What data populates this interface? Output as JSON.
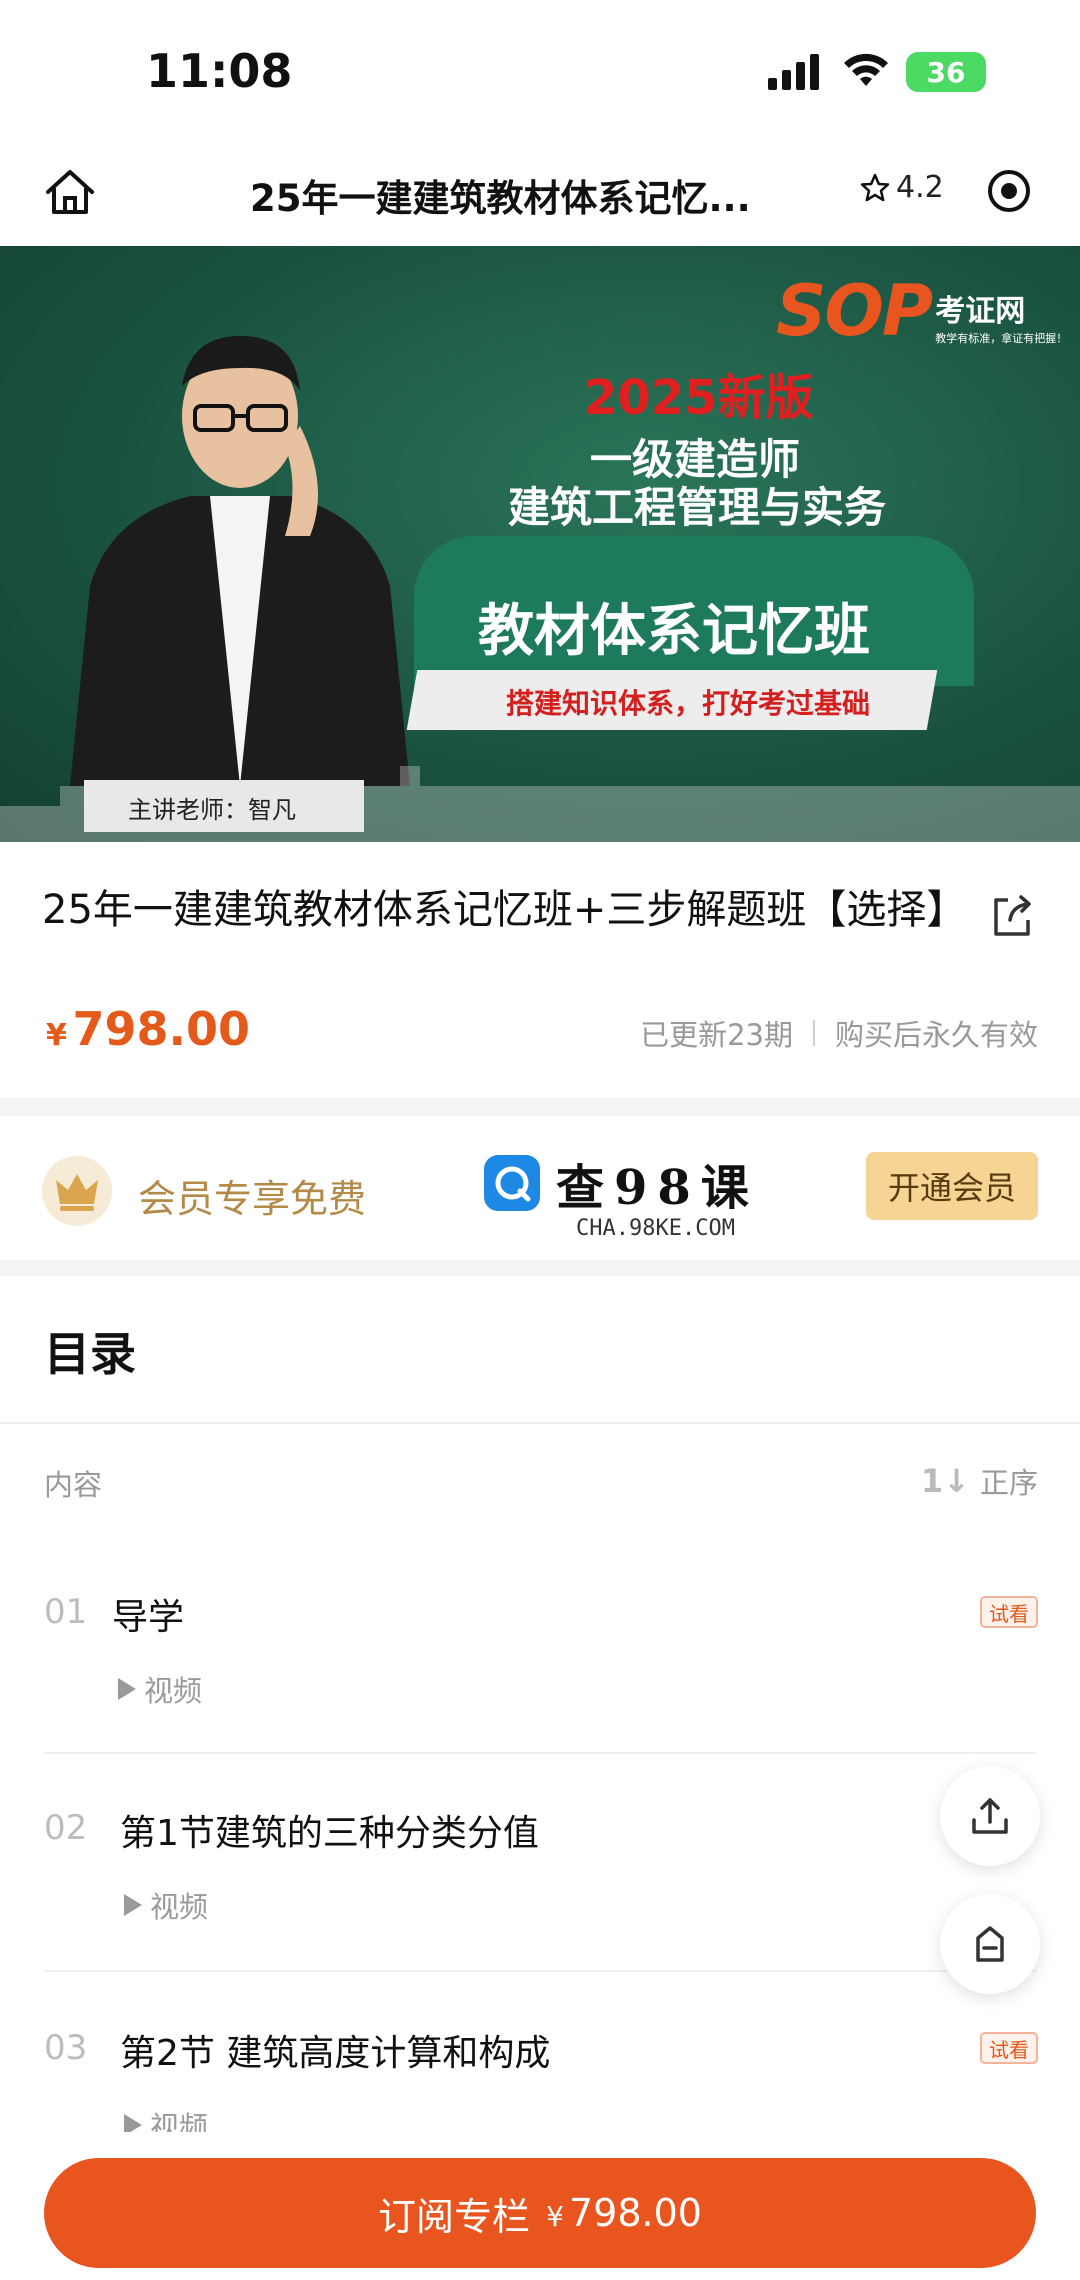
{
  "status": {
    "time": "11:08",
    "battery": "36"
  },
  "nav": {
    "title": "25年一建建筑教材体系记忆...",
    "rating": "4.2"
  },
  "banner": {
    "logo": "SOP",
    "logo_cn": "考证网",
    "logo_slogan": "教学有标准，拿证有把握！",
    "year": "2025新版",
    "line1": "一级建造师",
    "line2": "建筑工程管理与实务",
    "main": "教材体系记忆班",
    "sub": "搭建知识体系，打好考过基础",
    "teacher": "主讲老师：智凡"
  },
  "course": {
    "title": "25年一建建筑教材体系记忆班+三步解题班【选择】",
    "price_symbol": "¥",
    "price": "798.00",
    "updated": "已更新23期",
    "validity": "购买后永久有效"
  },
  "member": {
    "text": "会员专享免费",
    "button": "开通会员",
    "watermark": "查98课",
    "watermark_sub": "CHA.98KE.COM"
  },
  "catalog": {
    "heading": "目录",
    "column_label": "内容",
    "sort_icon": "1↓",
    "sort_label": "正序",
    "lessons": [
      {
        "num": "01",
        "title": "导学",
        "type": "视频",
        "trial": "试看"
      },
      {
        "num": "02",
        "title": "第1节建筑的三种分类分值",
        "type": "视频",
        "trial": ""
      },
      {
        "num": "03",
        "title": "第2节 建筑高度计算和构成",
        "type": "视频",
        "trial": "试看"
      }
    ]
  },
  "footer": {
    "label": "订阅专栏",
    "price_symbol": "¥",
    "price": "798.00"
  },
  "colors": {
    "accent": "#e8551f",
    "gold": "#b48a48",
    "banner": "#1e5b47"
  }
}
